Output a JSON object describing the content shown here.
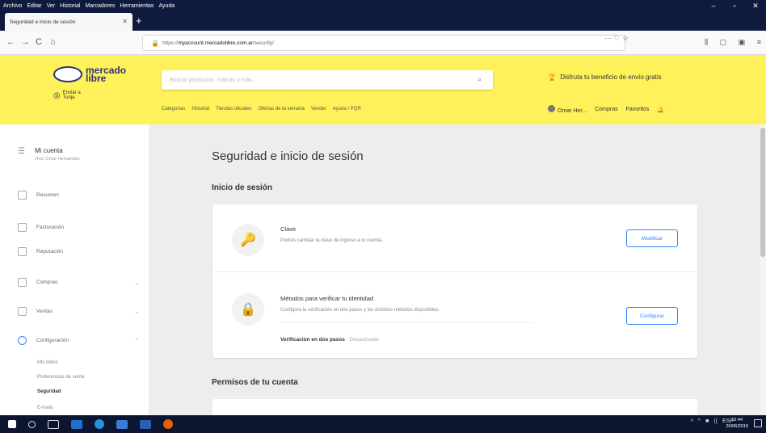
{
  "browser": {
    "menu": [
      "Archivo",
      "Editar",
      "Ver",
      "Historial",
      "Marcadores",
      "Herramientas",
      "Ayuda"
    ],
    "window_controls": [
      "–",
      "▫",
      "✕"
    ],
    "tab_title": "Seguridad e inicio de sesión",
    "tab_close": "✕",
    "new_tab": "+",
    "url_prefix": "https://",
    "url_domain": "myaccount.mercadolibre.com.ar",
    "url_path": "/security/",
    "url_actions": "··· ♡ ☆",
    "nav_icons": [
      "←",
      "→",
      "C",
      "⌂"
    ],
    "right_icons": [
      "⫼",
      "▢",
      "▣",
      "≡"
    ]
  },
  "ml_header": {
    "logo_line1": "mercado",
    "logo_line2": "libre",
    "location_line1": "Enviar a",
    "location_line2": "Tunja",
    "search_placeholder": "Buscar productos, marcas y más...",
    "promo": "Disfruta tu beneficio de envío gratis",
    "categories": [
      "Categorías",
      "Historial",
      "Tiendas oficiales",
      "Ofertas de la semana",
      "Vender",
      "Ayuda / PQR"
    ],
    "user_name": "Omar Her...",
    "user_links": [
      "Compras",
      "Favoritos"
    ]
  },
  "sidebar": {
    "account_title": "Mi cuenta",
    "account_sub": "Jhon Omar Hernandez",
    "items": [
      {
        "label": "Resumen",
        "chevron": ""
      },
      {
        "label": "Facturación",
        "chevron": ""
      },
      {
        "label": "Reputación",
        "chevron": ""
      },
      {
        "label": "Compras",
        "chevron": "⌄"
      },
      {
        "label": "Ventas",
        "chevron": "⌄"
      },
      {
        "label": "Configuración",
        "chevron": "⌃"
      }
    ],
    "subitems": [
      "Mis datos",
      "Preferencias de venta",
      "Seguridad",
      "E-mails"
    ]
  },
  "main": {
    "page_title": "Seguridad e inicio de sesión",
    "section_login": "Inicio de sesión",
    "password_title": "Clave",
    "password_desc": "Podrás cambiar la clave de ingreso a tu cuenta.",
    "password_button": "Modificar",
    "verify_title": "Métodos para verificar tu identidad",
    "verify_desc": "Configura la verificación en dos pasos y los distintos métodos disponibles.",
    "verify_button": "Configurar",
    "twostep_label": "Verificación en dos pasos",
    "twostep_state": "Desactivada",
    "section_permissions": "Permisos de tu cuenta"
  },
  "taskbar": {
    "tray": [
      "ᵃ",
      "^",
      "■",
      "((",
      "ESP"
    ],
    "clock_time": "12:44",
    "clock_date": "20/06/2019"
  },
  "colors": {
    "header_yellow": "#fff159",
    "accent_blue": "#3483fa",
    "browser_dark": "#0e1b3f"
  }
}
